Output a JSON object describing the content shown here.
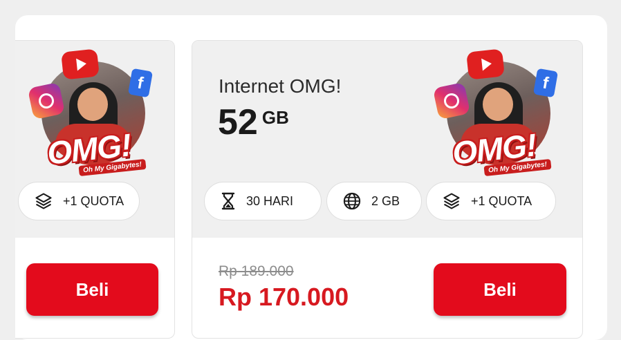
{
  "cards": [
    {
      "promo": {
        "logo_text": "OMG!",
        "tagline": "Oh My Gigabytes!",
        "fb_glyph": "f"
      },
      "chips": [
        {
          "label": "+1 QUOTA",
          "icon": "layers-icon"
        }
      ],
      "buy_label": "Beli"
    },
    {
      "title": "Internet OMG!",
      "quota_value": "52",
      "quota_unit": "GB",
      "promo": {
        "logo_text": "OMG!",
        "tagline": "Oh My Gigabytes!",
        "fb_glyph": "f"
      },
      "chips": [
        {
          "label": "30 HARI",
          "icon": "hourglass-icon"
        },
        {
          "label": "2 GB",
          "icon": "globe-icon"
        },
        {
          "label": "+1 QUOTA",
          "icon": "layers-icon"
        }
      ],
      "original_price": "Rp 189.000",
      "price": "Rp 170.000",
      "buy_label": "Beli"
    }
  ],
  "colors": {
    "accent_red": "#e30b1c",
    "price_red": "#d71920",
    "card_bg": "#f0f0f0"
  }
}
